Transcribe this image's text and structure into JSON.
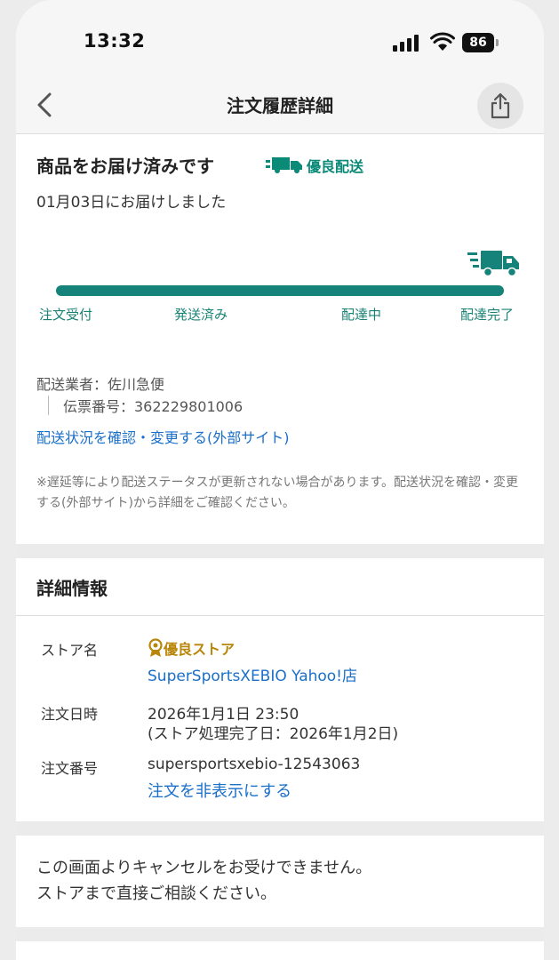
{
  "status_bar": {
    "time": "13:32",
    "battery": "86"
  },
  "nav": {
    "title": "注文履歴詳細"
  },
  "delivery": {
    "heading": "商品をお届け済みです",
    "badge": "優良配送",
    "date_text": "01月03日にお届けしました",
    "progress": 1.0,
    "steps": [
      "注文受付",
      "発送済み",
      "配達中",
      "配達完了"
    ],
    "carrier": "配送業者：佐川急便",
    "tracking": "伝票番号：362229801006",
    "tracking_link": "配送状況を確認・変更する(外部サイト)",
    "note": "※遅延等により配送ステータスが更新されない場合があります。配送状況を確認・変更する(外部サイト)から詳細をご確認ください。"
  },
  "details": {
    "title": "詳細情報",
    "store_label": "ストア名",
    "store_badge": "優良ストア",
    "store_name": "SuperSportsXEBIO Yahoo!店",
    "date_label": "注文日時",
    "date_value": "2026年1月1日 23:50",
    "date_sub": "(ストア処理完了日：2026年1月2日)",
    "order_label": "注文番号",
    "order_value": "supersportsxebio-12543063",
    "hide_link": "注文を非表示にする"
  },
  "cancel": {
    "line1": "この画面よりキャンセルをお受けできません。",
    "line2": "ストアまで直接ご相談ください。"
  },
  "colors": {
    "accent": "#16837a",
    "link": "#1a6fc9",
    "gold": "#b8860b"
  }
}
